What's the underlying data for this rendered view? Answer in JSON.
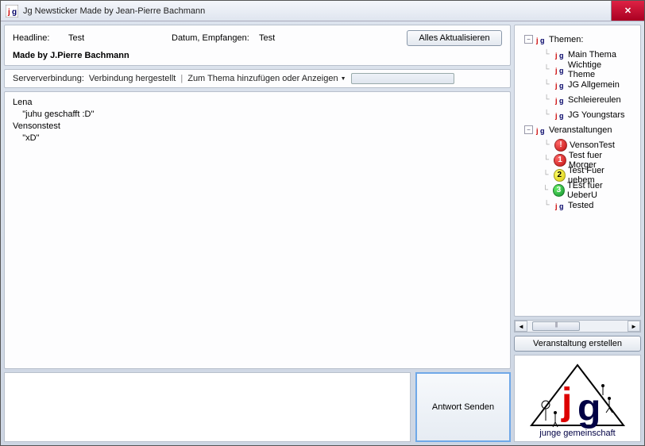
{
  "window": {
    "title": "Jg Newsticker Made by Jean-Pierre Bachmann"
  },
  "header": {
    "headline_label": "Headline:",
    "headline_value": "Test",
    "date_label": "Datum, Empfangen:",
    "date_value": "Test",
    "refresh_button": "Alles Aktualisieren",
    "author_line": "Made by J.Pierre Bachmann"
  },
  "serverbar": {
    "status_label": "Serververbindung:",
    "status_value": "Verbindung hergestellt",
    "menu_label": "Zum Thema hinzufügen oder Anzeigen"
  },
  "content_text": "Lena\n    \"juhu geschafft :D\"\nVensonstest\n    \"xD\"",
  "compose": {
    "send_button": "Antwort Senden"
  },
  "tree": {
    "root1": {
      "label": "Themen:",
      "children": [
        {
          "label": "Main Thema"
        },
        {
          "label": "Wichtige Theme"
        },
        {
          "label": "JG Allgemein"
        },
        {
          "label": "Schleiereulen"
        },
        {
          "label": "JG Youngstars"
        }
      ]
    },
    "root2": {
      "label": "Veranstaltungen",
      "children": [
        {
          "label": "VensonTest",
          "badge": "red",
          "num": "!"
        },
        {
          "label": "Test fuer Morger",
          "badge": "red",
          "num": "1"
        },
        {
          "label": "Test Fuer uebem",
          "badge": "yellow",
          "num": "2"
        },
        {
          "label": "TEst fuer UeberU",
          "badge": "green",
          "num": "3"
        },
        {
          "label": "Tested"
        }
      ]
    }
  },
  "right_actions": {
    "create_event": "Veranstaltung erstellen"
  },
  "logo": {
    "caption": "junge gemeinschaft"
  }
}
